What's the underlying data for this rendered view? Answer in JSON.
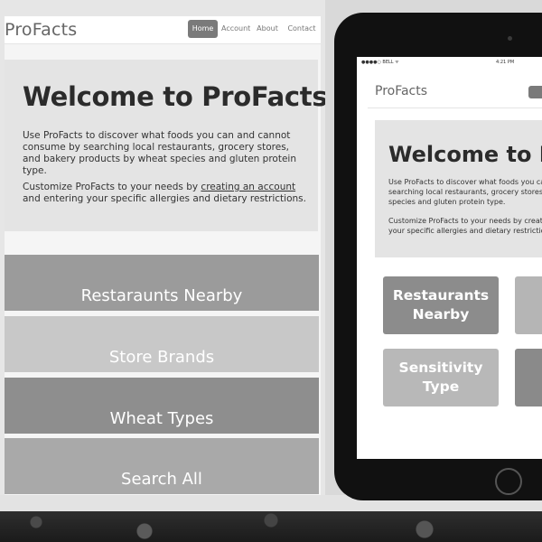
{
  "left": {
    "brand": "ProFacts",
    "nav": [
      {
        "label": "Home",
        "active": true
      },
      {
        "label": "Account",
        "active": false
      },
      {
        "label": "About",
        "active": false
      },
      {
        "label": "Contact",
        "active": false
      }
    ],
    "hero": {
      "title": "Welcome to ProFacts",
      "p1": "Use ProFacts to discover what foods you can and cannot consume by searching local restaurants, grocery stores, and bakery products by wheat species and gluten protein type.",
      "p2_before": "Customize ProFacts to your needs by ",
      "p2_link": "creating an account",
      "p2_after": " and entering your specific allergies and dietary restrictions."
    },
    "tiles": [
      {
        "label": "Restaraunts Nearby",
        "color": "#9b9b9b"
      },
      {
        "label": "Store Brands",
        "color": "#c8c8c8"
      },
      {
        "label": "Wheat Types",
        "color": "#8e8e8e"
      },
      {
        "label": "Search All",
        "color": "#a9a9a9"
      }
    ]
  },
  "ipad": {
    "carrier": "●●●●○ BELL ᯤ",
    "time": "4:21 PM",
    "brand": "ProFacts",
    "hero": {
      "title": "Welcome to ProFacts",
      "p1": "Use ProFacts to discover what foods you can and cannot consume by searching local restaurants, grocery stores, and bakery products by wheat species and gluten protein type.",
      "p2": "Customize ProFacts to your needs by creating an account and entering your specific allergies and dietary restrictions."
    },
    "tiles": [
      {
        "line1": "Restaurants",
        "line2": "Nearby",
        "color": "#8c8c8c"
      },
      {
        "line1": "",
        "line2": "",
        "color": "#b5b5b5"
      },
      {
        "line1": "Sensitivity",
        "line2": "Type",
        "color": "#b8b8b8"
      },
      {
        "line1": "",
        "line2": "",
        "color": "#8a8a8a"
      }
    ]
  }
}
